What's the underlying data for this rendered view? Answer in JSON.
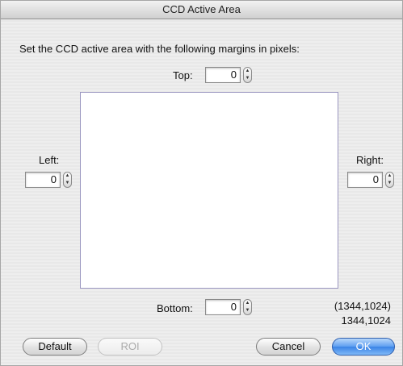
{
  "window": {
    "title": "CCD Active Area"
  },
  "dialog": {
    "instructions": "Set the CCD active area with the following margins in pixels:",
    "top": {
      "label": "Top:",
      "value": "0"
    },
    "left": {
      "label": "Left:",
      "value": "0"
    },
    "right": {
      "label": "Right:",
      "value": "0"
    },
    "bottom": {
      "label": "Bottom:",
      "value": "0"
    },
    "size_paren": "(1344,1024)",
    "size_plain": "1344,1024"
  },
  "buttons": {
    "default_label": "Default",
    "roi_label": "ROI",
    "cancel_label": "Cancel",
    "ok_label": "OK"
  },
  "icons": {
    "stepper_up": "stepper-up-icon",
    "stepper_down": "stepper-down-icon"
  }
}
